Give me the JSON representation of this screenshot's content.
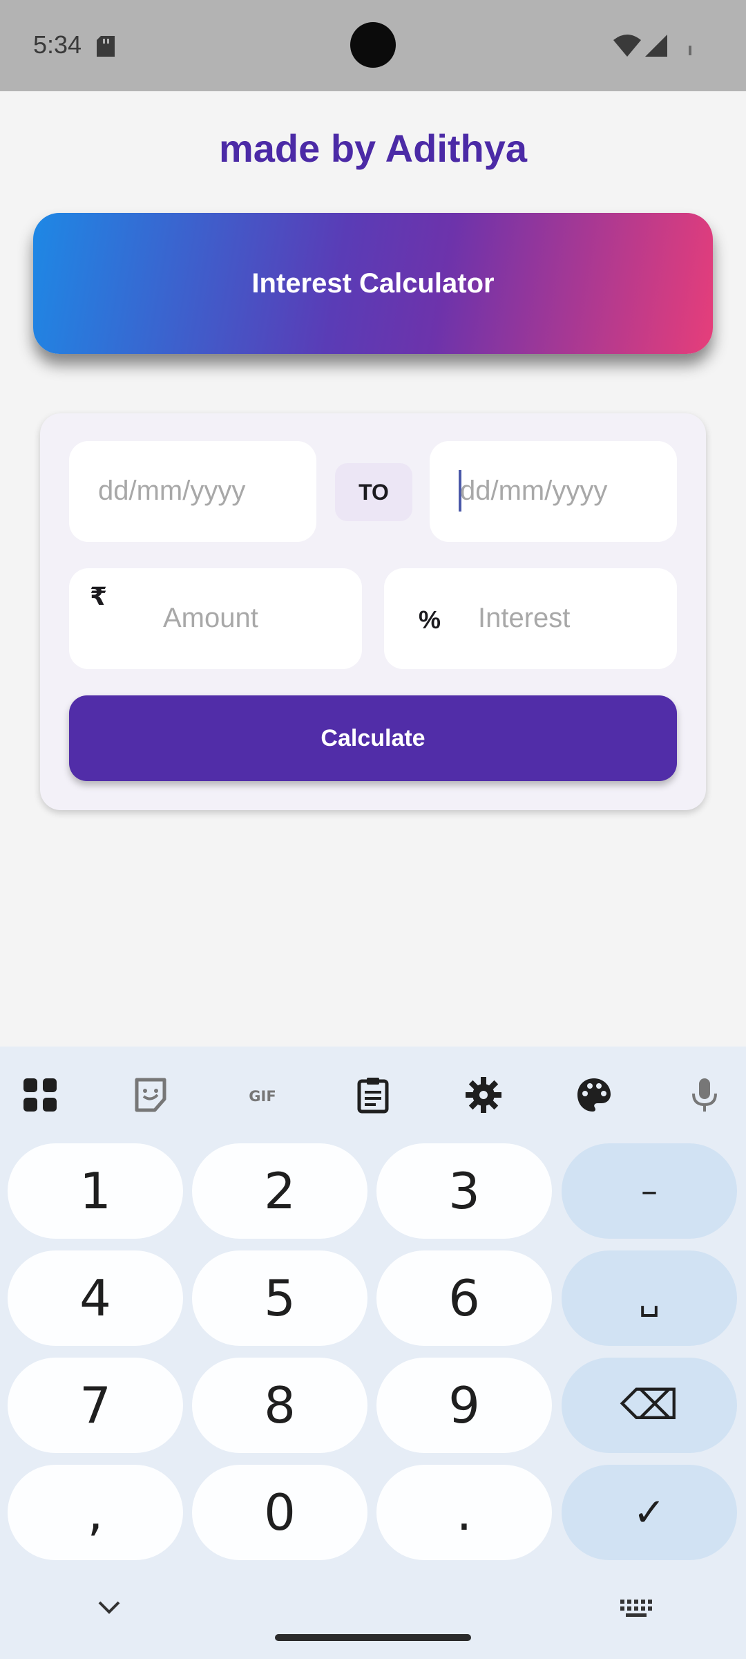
{
  "status_bar": {
    "time": "5:34",
    "icons": [
      "sd-card-icon",
      "wifi-icon",
      "signal-icon",
      "battery-icon"
    ]
  },
  "header": {
    "title": "made by Adithya",
    "title_color": "#4b2aa6"
  },
  "banner": {
    "title": "Interest Calculator",
    "gradient_start": "#1e88e5",
    "gradient_end": "#e63e7a"
  },
  "form": {
    "from_date": {
      "value": "",
      "placeholder": "dd/mm/yyyy"
    },
    "to_label": "TO",
    "to_date": {
      "value": "",
      "placeholder": "dd/mm/yyyy",
      "focused": true
    },
    "amount": {
      "value": "",
      "placeholder": "Amount",
      "prefix": "₹"
    },
    "interest": {
      "value": "",
      "placeholder": "Interest",
      "prefix": "%"
    },
    "calculate_label": "Calculate",
    "accent_color": "#512da8"
  },
  "keyboard": {
    "toolbar": [
      "apps-icon",
      "sticker-icon",
      "gif-icon",
      "clipboard-icon",
      "settings-icon",
      "palette-icon",
      "mic-icon"
    ],
    "rows": [
      [
        "1",
        "2",
        "3",
        "–"
      ],
      [
        "4",
        "5",
        "6",
        "␣"
      ],
      [
        "7",
        "8",
        "9",
        "⌫"
      ],
      [
        ",",
        "0",
        ".",
        "✓"
      ]
    ],
    "gif_label": "GIF"
  }
}
